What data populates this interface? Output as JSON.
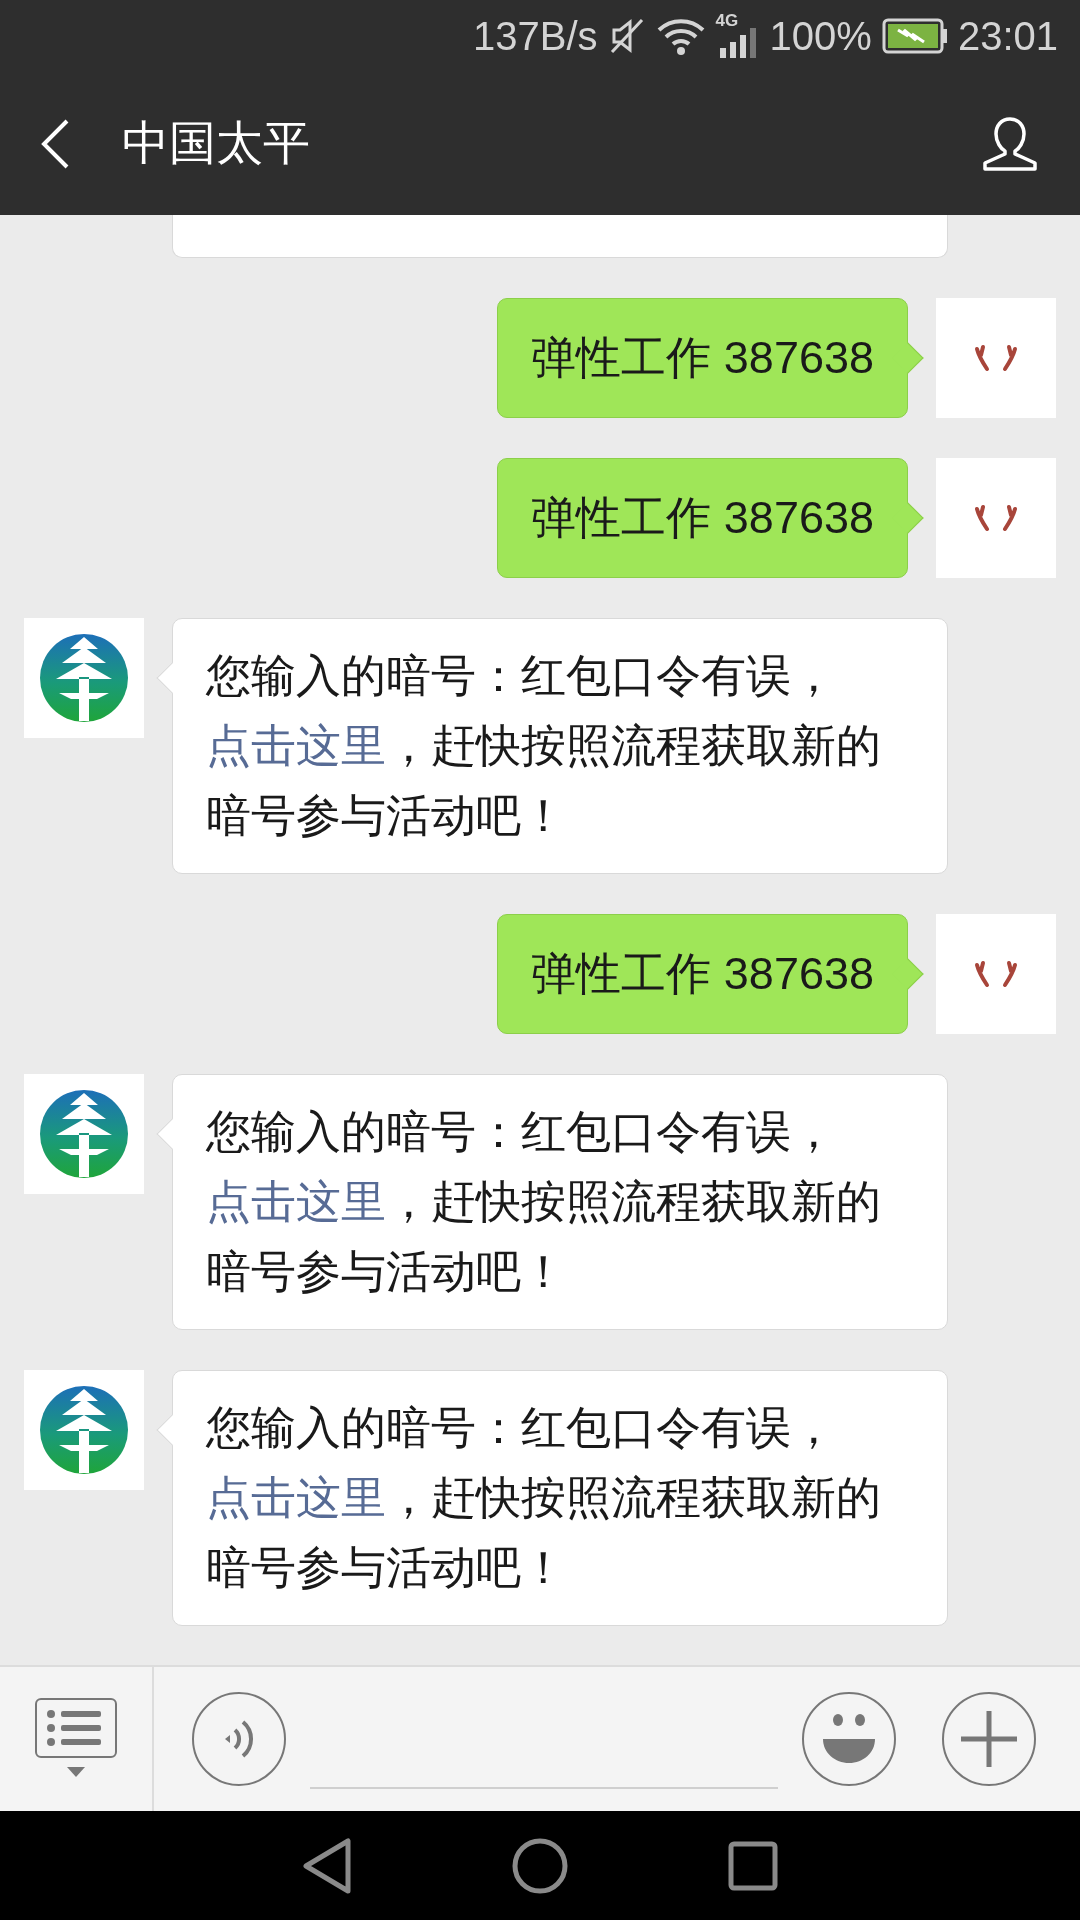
{
  "status_bar": {
    "network_speed": "137B/s",
    "network_type": "4G",
    "battery": "100%",
    "time": "23:01"
  },
  "header": {
    "title": "中国太平"
  },
  "messages": [
    {
      "kind": "cut_off"
    },
    {
      "kind": "sent",
      "text": "弹性工作 387638"
    },
    {
      "kind": "sent",
      "text": "弹性工作 387638"
    },
    {
      "kind": "received",
      "parts": [
        {
          "text": "您输入的暗号：红包口令有误，",
          "link": false
        },
        {
          "text": "点击这里",
          "link": true
        },
        {
          "text": "，赶快按照流程获取新的暗号参与活动吧！",
          "link": false
        }
      ]
    },
    {
      "kind": "sent",
      "text": "弹性工作 387638"
    },
    {
      "kind": "received",
      "parts": [
        {
          "text": "您输入的暗号：红包口令有误，",
          "link": false
        },
        {
          "text": "点击这里",
          "link": true
        },
        {
          "text": "，赶快按照流程获取新的暗号参与活动吧！",
          "link": false
        }
      ]
    },
    {
      "kind": "received",
      "parts": [
        {
          "text": "您输入的暗号：红包口令有误，",
          "link": false
        },
        {
          "text": "点击这里",
          "link": true
        },
        {
          "text": "，赶快按照流程获取新的暗号参与活动吧！",
          "link": false
        }
      ]
    }
  ]
}
